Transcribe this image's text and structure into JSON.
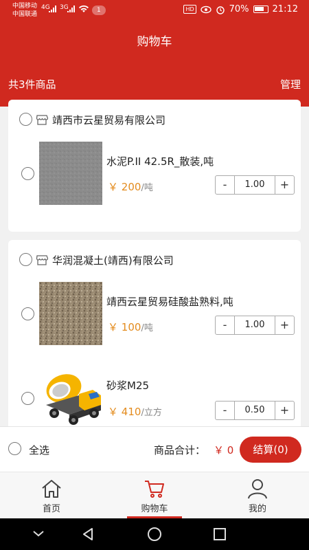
{
  "status": {
    "carrier1": "中国移动",
    "carrier2": "中国联通",
    "sig1": "4G",
    "sig2": "3G",
    "badge": "1",
    "hd": "HD",
    "battery": "70%",
    "time": "21:12"
  },
  "header": {
    "title": "购物车",
    "count": "共3件商品",
    "manage": "管理"
  },
  "stores": [
    {
      "name": "靖西市云星贸易有限公司",
      "items": [
        {
          "name": "水泥P.II 42.5R_散装,吨",
          "currency": "￥",
          "price": "200",
          "unit": "/吨",
          "qty": "1.00",
          "minus": "-",
          "plus": "+"
        }
      ]
    },
    {
      "name": "华润混凝土(靖西)有限公司",
      "items": [
        {
          "name": "靖西云星贸易硅酸盐熟料,吨",
          "currency": "￥",
          "price": "100",
          "unit": "/吨",
          "qty": "1.00",
          "minus": "-",
          "plus": "+"
        },
        {
          "name": "砂浆M25",
          "currency": "￥",
          "price": "410",
          "unit": "/立方",
          "qty": "0.50",
          "minus": "-",
          "plus": "+"
        }
      ]
    }
  ],
  "footer": {
    "select_all": "全选",
    "total_label": "商品合计：",
    "total_value": "￥ 0",
    "checkout": "结算(0)"
  },
  "tabs": [
    {
      "label": "首页",
      "icon": "home-icon"
    },
    {
      "label": "购物车",
      "icon": "cart-icon",
      "active": true
    },
    {
      "label": "我的",
      "icon": "user-icon"
    }
  ],
  "colors": {
    "brand": "#d0291f",
    "price": "#e38b1d"
  }
}
